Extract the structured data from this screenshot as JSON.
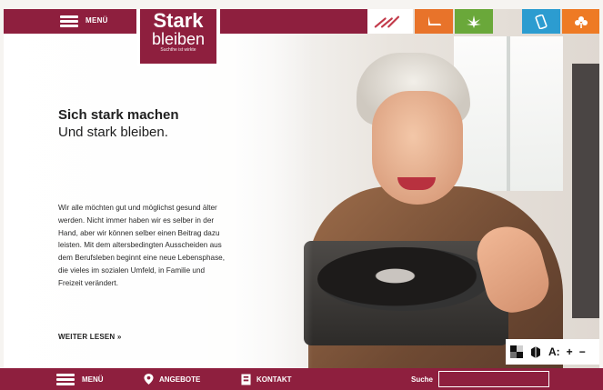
{
  "colors": {
    "brand": "#8e1f3e",
    "tab_orange": "#e8732a",
    "tab_green": "#6aa83a",
    "tab_blue": "#2c9cd0",
    "tab_orange2": "#ee7a24"
  },
  "header": {
    "menu_label": "MENÜ",
    "logo": {
      "line1": "Stark",
      "line2": "bleiben",
      "tagline": "Suchthe ist wirkte"
    },
    "tabs": [
      {
        "icon": "swoosh-brand-icon"
      },
      {
        "icon": "shoe-icon"
      },
      {
        "icon": "cannabis-leaf-icon"
      },
      {
        "icon": "phone-icon"
      },
      {
        "icon": "leaf-icon"
      }
    ]
  },
  "hero": {
    "title": "Sich stark machen",
    "subtitle": "Und stark bleiben.",
    "body_lines": [
      "Wir alle möchten gut und möglichst gesund älter",
      "werden. Nicht immer haben wir es selber in der",
      "Hand, aber wir können selber einen Beitrag dazu",
      "leisten. Mit dem altersbedingten Ausscheiden aus",
      "dem Berufsleben beginnt eine neue Lebensphase,",
      "die vieles im sozialen Umfeld, in Familie und",
      "Freizeit verändert."
    ],
    "read_more": "WEITER LESEN »"
  },
  "accessibility": {
    "font_size_label": "A:",
    "plus": "+",
    "minus": "−"
  },
  "footer": {
    "menu_label": "MENÜ",
    "offers_label": "ANGEBOTE",
    "contact_label": "KONTAKT",
    "search_label": "Suche",
    "search_value": ""
  }
}
